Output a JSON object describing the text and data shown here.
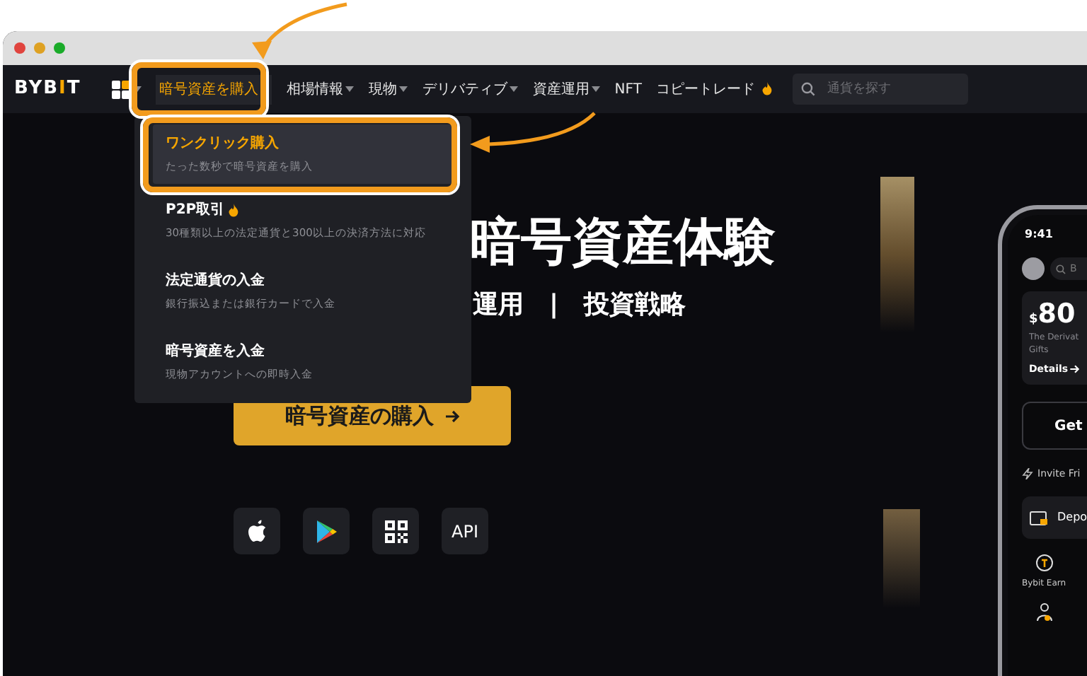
{
  "window": {
    "controls": [
      {
        "color": "#e0443e"
      },
      {
        "color": "#dea123"
      },
      {
        "color": "#1aab29"
      }
    ]
  },
  "nav": {
    "logo": "BYBIT",
    "items": [
      {
        "label": "暗号資産を購入",
        "selected": true,
        "has_menu": true,
        "hot": false
      },
      {
        "label": "相場情報",
        "selected": false,
        "has_menu": true,
        "hot": false
      },
      {
        "label": "現物",
        "selected": false,
        "has_menu": true,
        "hot": false
      },
      {
        "label": "デリバティブ",
        "selected": false,
        "has_menu": true,
        "hot": false
      },
      {
        "label": "資産運用",
        "selected": false,
        "has_menu": true,
        "hot": false
      },
      {
        "label": "NFT",
        "selected": false,
        "has_menu": false,
        "hot": false
      },
      {
        "label": "コピートレード",
        "selected": false,
        "has_menu": false,
        "hot": true
      }
    ],
    "search": {
      "placeholder": "通貨を探す"
    }
  },
  "menu": {
    "items": [
      {
        "title": "ワンクリック購入",
        "description": "たった数秒で暗号資産を購入",
        "selected": true,
        "hot": false
      },
      {
        "title": "P2P取引",
        "description": "30種類以上の法定通貨と300以上の決済方法に対応",
        "selected": false,
        "hot": true
      },
      {
        "title": "法定通貨の入金",
        "description": "銀行振込または銀行カードで入金",
        "selected": false,
        "hot": false
      },
      {
        "title": "暗号資産を入金",
        "description": "現物アカウントへの即時入金",
        "selected": false,
        "hot": false
      }
    ]
  },
  "hero": {
    "headline": "暗号資産体験",
    "subtitle": [
      "運用",
      "|",
      "投資戦略"
    ],
    "button": "暗号資産の購入",
    "downloads": [
      {
        "kind": "apple"
      },
      {
        "kind": "play"
      },
      {
        "kind": "qr"
      },
      {
        "kind": "text",
        "label": "API"
      }
    ]
  },
  "phone": {
    "time": "9:41",
    "search_placeholder": "B",
    "currency": "$",
    "amount": "80",
    "promo": [
      "The Derivat",
      "Gifts"
    ],
    "details": "Details",
    "get_button": "Get",
    "invite": "Invite Fri",
    "deposit": "Depo",
    "earn": "Bybit Earn"
  }
}
